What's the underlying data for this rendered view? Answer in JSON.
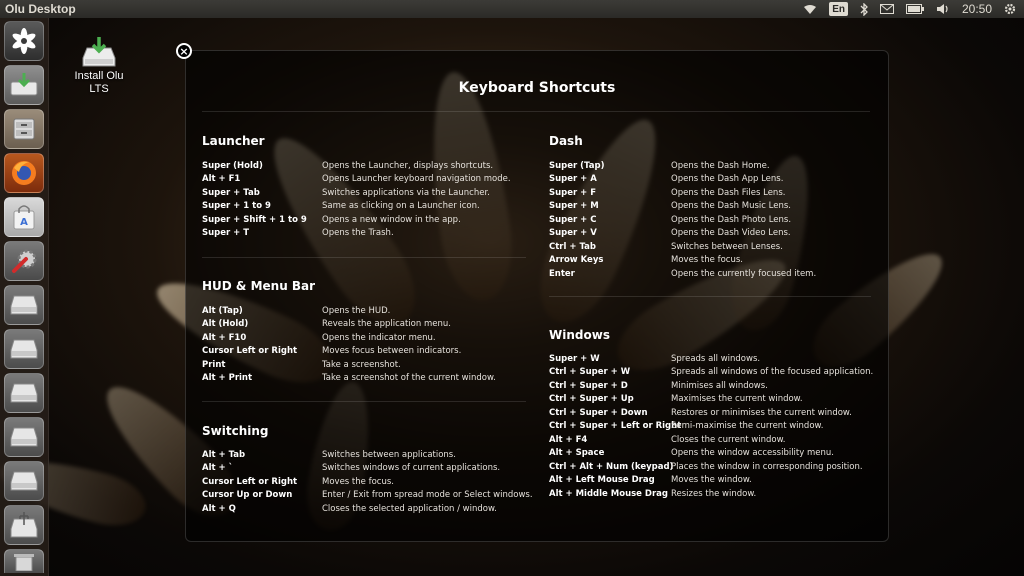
{
  "top_panel": {
    "title": "Olu Desktop",
    "keyboard_layout": "En",
    "clock": "20:50",
    "indicator_icons": [
      "wifi-icon",
      "keyboard-layout-indicator",
      "bluetooth-icon",
      "mail-icon",
      "battery-icon",
      "volume-icon",
      "clock",
      "power-gear-icon"
    ]
  },
  "launcher": {
    "items": [
      {
        "name": "dash-home",
        "icon": "flower-logo-icon"
      },
      {
        "name": "install-olu",
        "icon": "install-disk-icon"
      },
      {
        "name": "files",
        "icon": "file-cabinet-icon"
      },
      {
        "name": "firefox",
        "icon": "firefox-icon"
      },
      {
        "name": "software-center",
        "icon": "shopping-bag-icon"
      },
      {
        "name": "system-settings",
        "icon": "settings-wrench-icon"
      },
      {
        "name": "drive-1",
        "icon": "hard-drive-icon"
      },
      {
        "name": "drive-2",
        "icon": "hard-drive-icon"
      },
      {
        "name": "drive-3",
        "icon": "hard-drive-icon"
      },
      {
        "name": "drive-4",
        "icon": "hard-drive-icon"
      },
      {
        "name": "drive-5",
        "icon": "hard-drive-icon"
      },
      {
        "name": "usb-drive",
        "icon": "usb-drive-icon"
      },
      {
        "name": "trash",
        "icon": "trash-icon"
      }
    ]
  },
  "desktop": {
    "install_icon_label": "Install Olu LTS"
  },
  "overlay": {
    "title": "Keyboard Shortcuts",
    "close_label": "×",
    "sections": {
      "launcher": {
        "title": "Launcher",
        "rows": [
          {
            "key": "Super (Hold)",
            "desc": "Opens the Launcher, displays shortcuts."
          },
          {
            "key": "Alt + F1",
            "desc": "Opens Launcher keyboard navigation mode."
          },
          {
            "key": "Super + Tab",
            "desc": "Switches applications via the Launcher."
          },
          {
            "key": "Super + 1 to 9",
            "desc": "Same as clicking on a Launcher icon."
          },
          {
            "key": "Super + Shift + 1 to 9",
            "desc": "Opens a new window in the app."
          },
          {
            "key": "Super + T",
            "desc": "Opens the Trash."
          }
        ]
      },
      "hud": {
        "title": "HUD & Menu Bar",
        "rows": [
          {
            "key": "Alt (Tap)",
            "desc": "Opens the HUD."
          },
          {
            "key": "Alt (Hold)",
            "desc": "Reveals the application menu."
          },
          {
            "key": "Alt + F10",
            "desc": "Opens the indicator menu."
          },
          {
            "key": "Cursor Left or Right",
            "desc": "Moves focus between indicators."
          },
          {
            "key": "Print",
            "desc": "Take a screenshot."
          },
          {
            "key": "Alt + Print",
            "desc": "Take a screenshot of the current window."
          }
        ]
      },
      "switching": {
        "title": "Switching",
        "rows": [
          {
            "key": "Alt + Tab",
            "desc": "Switches between applications."
          },
          {
            "key": "Alt + `",
            "desc": "Switches windows of current applications."
          },
          {
            "key": "Cursor Left or Right",
            "desc": "Moves the focus."
          },
          {
            "key": "Cursor Up or Down",
            "desc": "Enter / Exit from spread mode or Select windows."
          },
          {
            "key": "Alt + Q",
            "desc": "Closes the selected application / window."
          }
        ]
      },
      "dash": {
        "title": "Dash",
        "rows": [
          {
            "key": "Super (Tap)",
            "desc": "Opens the Dash Home."
          },
          {
            "key": "Super + A",
            "desc": "Opens the Dash App Lens."
          },
          {
            "key": "Super + F",
            "desc": "Opens the Dash Files Lens."
          },
          {
            "key": "Super + M",
            "desc": "Opens the Dash Music Lens."
          },
          {
            "key": "Super + C",
            "desc": "Opens the Dash Photo Lens."
          },
          {
            "key": "Super + V",
            "desc": "Opens the Dash Video Lens."
          },
          {
            "key": "Ctrl + Tab",
            "desc": "Switches between Lenses."
          },
          {
            "key": "Arrow Keys",
            "desc": "Moves the focus."
          },
          {
            "key": "Enter",
            "desc": "Opens the currently focused item."
          }
        ]
      },
      "windows": {
        "title": "Windows",
        "rows": [
          {
            "key": "Super + W",
            "desc": "Spreads all windows."
          },
          {
            "key": "Ctrl + Super + W",
            "desc": "Spreads all windows of the focused application."
          },
          {
            "key": "Ctrl + Super + D",
            "desc": "Minimises all windows."
          },
          {
            "key": "Ctrl + Super + Up",
            "desc": "Maximises the current window."
          },
          {
            "key": "Ctrl + Super + Down",
            "desc": "Restores or minimises the current window."
          },
          {
            "key": "Ctrl + Super + Left or Right",
            "desc": "Semi-maximise the current window."
          },
          {
            "key": "Alt + F4",
            "desc": "Closes the current window."
          },
          {
            "key": "Alt + Space",
            "desc": "Opens the window accessibility menu."
          },
          {
            "key": "Ctrl + Alt + Num (keypad)",
            "desc": "Places the window in corresponding position."
          },
          {
            "key": "Alt + Left Mouse Drag",
            "desc": "Moves the window."
          },
          {
            "key": "Alt + Middle Mouse Drag",
            "desc": "Resizes the window."
          }
        ]
      }
    }
  },
  "colors": {
    "panel": "#2b2a27",
    "overlay_bg": "#000000",
    "text": "#ffffff"
  }
}
